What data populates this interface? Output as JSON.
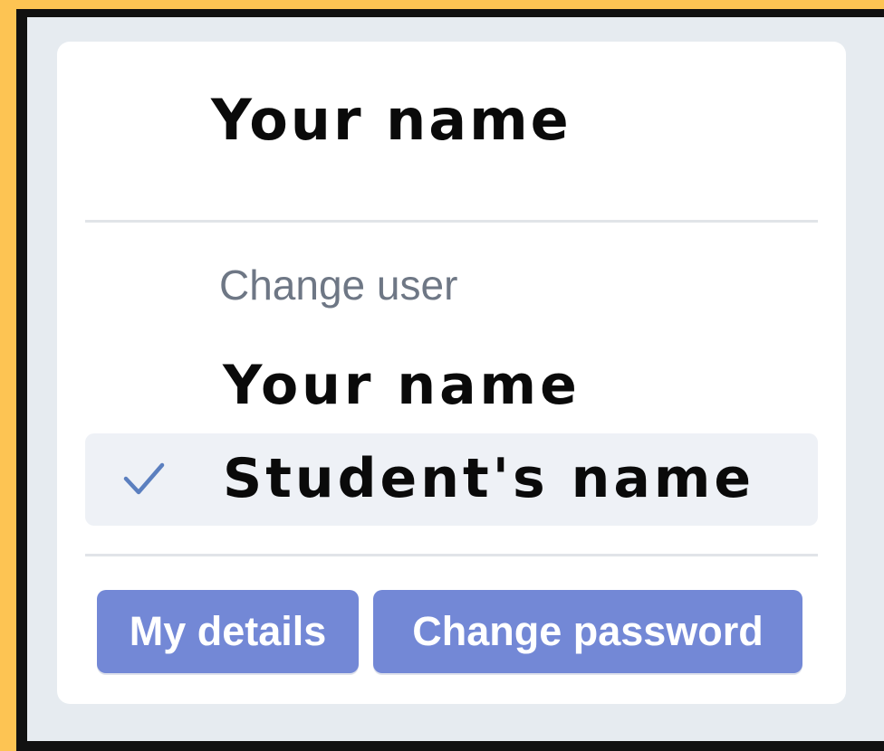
{
  "menu": {
    "current_user_name": "Your name",
    "section_label": "Change user",
    "users": [
      {
        "label": "Your name",
        "selected": false
      },
      {
        "label": "Student's name",
        "selected": true
      }
    ],
    "buttons": {
      "my_details": "My details",
      "change_password": "Change password"
    }
  },
  "icons": {
    "selected_marker": "check-icon"
  },
  "colors": {
    "page_background": "#fdc453",
    "panel_background": "#e6ebf0",
    "button_background": "#7388d6",
    "selected_row_background": "#eef1f6",
    "check_color": "#5b7fbf",
    "section_label_color": "#6e7785"
  }
}
